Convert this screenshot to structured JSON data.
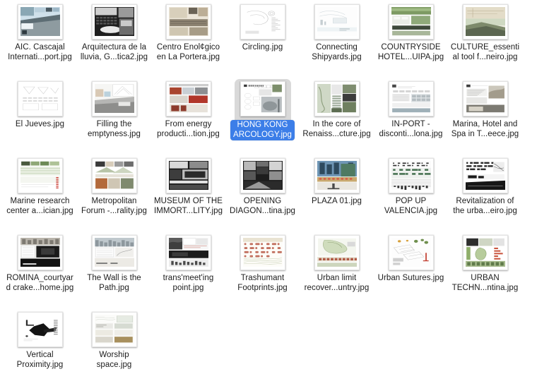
{
  "view": {
    "name": "finder-icon-view",
    "background_color": "#ffffff",
    "columns": 7,
    "rows": 5,
    "selection_color": "#3c7ee8",
    "selection_backdrop_color": "#d9d9d9",
    "label_color": "#1c1c1c",
    "total_items": 30
  },
  "items": [
    {
      "label": "AIC. Cascajal\nInternati...port.jpg",
      "selected": false,
      "thumb": "aic-cascajal"
    },
    {
      "label": "Arquitectura de la\nlluvia, G...tica2.jpg",
      "selected": false,
      "thumb": "arquitectura-lluvia"
    },
    {
      "label": "Centro Enol¢gico\nen La Portera.jpg",
      "selected": false,
      "thumb": "centro-enologico"
    },
    {
      "label": "Circling.jpg",
      "selected": false,
      "thumb": "circling"
    },
    {
      "label": "Connecting\nShipyards.jpg",
      "selected": false,
      "thumb": "connecting-shipyards"
    },
    {
      "label": "COUNTRYSIDE\nHOTEL...UIPA.jpg",
      "selected": false,
      "thumb": "countryside-hotel"
    },
    {
      "label": "CULTURE_essenti\nal tool f...neiro.jpg",
      "selected": false,
      "thumb": "culture-essential"
    },
    {
      "label": "El Jueves.jpg",
      "selected": false,
      "thumb": "el-jueves"
    },
    {
      "label": "Filling the\nemptyness.jpg",
      "selected": false,
      "thumb": "filling-emptyness"
    },
    {
      "label": "From energy\nproducti...tion.jpg",
      "selected": false,
      "thumb": "from-energy"
    },
    {
      "label": "HONG KONG\nARCOLOGY.jpg",
      "selected": true,
      "thumb": "hong-kong-arcology"
    },
    {
      "label": "In the core of\nRenaiss...cture.jpg",
      "selected": false,
      "thumb": "in-the-core"
    },
    {
      "label": "IN-PORT -\ndisconti...lona.jpg",
      "selected": false,
      "thumb": "in-port"
    },
    {
      "label": "Marina, Hotel and\nSpa in T...eece.jpg",
      "selected": false,
      "thumb": "marina-hotel-spa"
    },
    {
      "label": "Marine research\ncenter a...ician.jpg",
      "selected": false,
      "thumb": "marine-research"
    },
    {
      "label": "Metropolitan\nForum -...rality.jpg",
      "selected": false,
      "thumb": "metropolitan-forum"
    },
    {
      "label": "MUSEUM OF THE\nIMMORT...LITY.jpg",
      "selected": false,
      "thumb": "museum-immortality"
    },
    {
      "label": "OPENING\nDIAGON...tina.jpg",
      "selected": false,
      "thumb": "opening-diagonal"
    },
    {
      "label": "PLAZA 01.jpg",
      "selected": false,
      "thumb": "plaza-01"
    },
    {
      "label": "POP UP\nVALENCIA.jpg",
      "selected": false,
      "thumb": "pop-up-valencia"
    },
    {
      "label": "Revitalization of\nthe urba...eiro.jpg",
      "selected": false,
      "thumb": "revitalization-urban"
    },
    {
      "label": "ROMINA_courtyar\nd crake...home.jpg",
      "selected": false,
      "thumb": "romina-courtyard"
    },
    {
      "label": "The Wall is the\nPath.jpg",
      "selected": false,
      "thumb": "wall-is-the-path"
    },
    {
      "label": "trans'meet'ing\npoint.jpg",
      "selected": false,
      "thumb": "trans-meeting-point"
    },
    {
      "label": "Trashumant\nFootprints.jpg",
      "selected": false,
      "thumb": "trashumant-footprints"
    },
    {
      "label": "Urban limit\nrecover...untry.jpg",
      "selected": false,
      "thumb": "urban-limit"
    },
    {
      "label": "Urban Sutures.jpg",
      "selected": false,
      "thumb": "urban-sutures"
    },
    {
      "label": "URBAN\nTECHN...ntina.jpg",
      "selected": false,
      "thumb": "urban-techn"
    },
    {
      "label": "Vertical\nProximity.jpg",
      "selected": false,
      "thumb": "vertical-proximity"
    },
    {
      "label": "Worship\nspace.jpg",
      "selected": false,
      "thumb": "worship-space"
    }
  ]
}
